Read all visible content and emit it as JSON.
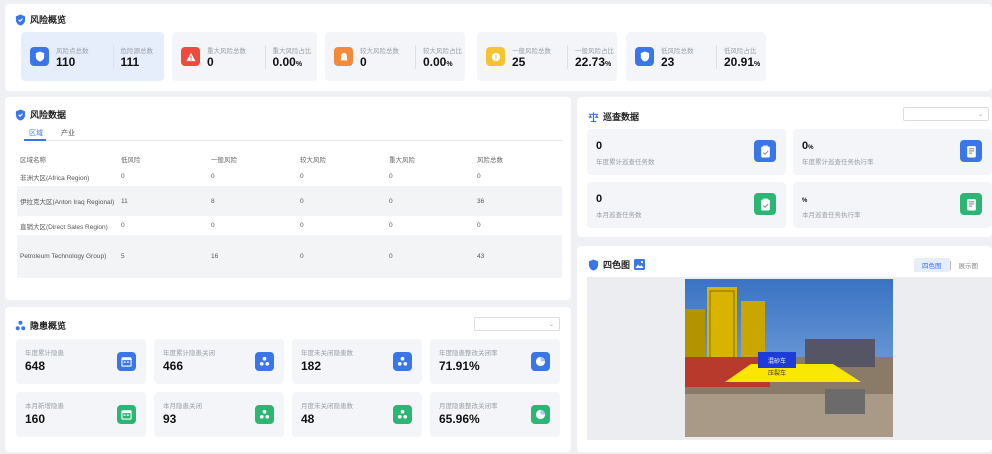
{
  "risk_overview": {
    "title": "风险概览",
    "stats": [
      {
        "labels": [
          "风险点总数",
          "危险源总数"
        ],
        "values": [
          "110",
          "111"
        ],
        "color": "#3a76e8",
        "icon": "shield-icon"
      },
      {
        "labels": [
          "重大风险总数",
          "重大风险占比"
        ],
        "values": [
          "0",
          "0.00"
        ],
        "unit": "%",
        "color": "#ee4b3e",
        "icon": "warning-triangle-icon"
      },
      {
        "labels": [
          "较大风险总数",
          "较大风险占比"
        ],
        "values": [
          "0",
          "0.00"
        ],
        "unit": "%",
        "color": "#f5893a",
        "icon": "bell-icon"
      },
      {
        "labels": [
          "一般风险总数",
          "一般风险占比"
        ],
        "values": [
          "25",
          "22.73"
        ],
        "unit": "%",
        "color": "#f4c430",
        "icon": "alert-circle-icon"
      },
      {
        "labels": [
          "低风险总数",
          "低风险占比"
        ],
        "values": [
          "23",
          "20.91"
        ],
        "unit": "%",
        "color": "#3a76e8",
        "icon": "shield-icon"
      }
    ]
  },
  "risk_data": {
    "title": "风险数据",
    "tabs": [
      "区域",
      "产业"
    ],
    "columns": [
      "区域名称",
      "低风险",
      "一般风险",
      "较大风险",
      "重大风险",
      "风险总数"
    ],
    "rows": [
      [
        "非洲大区(Africa Region)",
        "0",
        "0",
        "0",
        "0",
        "0"
      ],
      [
        "伊拉克大区(Anton Iraq Regional)",
        "11",
        "8",
        "0",
        "0",
        "36"
      ],
      [
        "直销大区(Direct Sales Region)",
        "0",
        "0",
        "0",
        "0",
        "0"
      ],
      [
        "Petroleum Technology Group)",
        "5",
        "16",
        "0",
        "0",
        "43"
      ]
    ]
  },
  "hazard_overview": {
    "title": "隐患概览",
    "cards": [
      {
        "label": "年度累计隐患",
        "value": "648",
        "color": "#3a76e8",
        "icon": "calendar-icon"
      },
      {
        "label": "年度累计隐患关闭",
        "value": "466",
        "color": "#3a76e8",
        "icon": "hazard-icon"
      },
      {
        "label": "年度未关闭隐患数",
        "value": "182",
        "color": "#3a76e8",
        "icon": "hazard-icon"
      },
      {
        "label": "年度隐患整改关闭率",
        "value": "71.91%",
        "color": "#3a76e8",
        "icon": "pie-icon"
      },
      {
        "label": "本月新增隐患",
        "value": "160",
        "color": "#2bb673",
        "icon": "calendar-icon"
      },
      {
        "label": "本月隐患关闭",
        "value": "93",
        "color": "#2bb673",
        "icon": "hazard-icon"
      },
      {
        "label": "月度未关闭隐患数",
        "value": "48",
        "color": "#2bb673",
        "icon": "hazard-icon"
      },
      {
        "label": "月度隐患整改关闭率",
        "value": "65.96%",
        "color": "#2bb673",
        "icon": "pie-icon"
      }
    ]
  },
  "patrol_data": {
    "title": "巡查数据",
    "cards": [
      {
        "value": "0",
        "unit": "",
        "label": "年度累计巡查任务数",
        "color": "#3a76e8",
        "icon": "clipboard-check-icon"
      },
      {
        "value": "0",
        "unit": "%",
        "label": "年度累计巡查任务执行率",
        "color": "#3a76e8",
        "icon": "report-icon"
      },
      {
        "value": "0",
        "unit": "",
        "label": "本月巡查任务数",
        "color": "#2bb673",
        "icon": "clipboard-check-icon"
      },
      {
        "value": "",
        "unit": "%",
        "label": "本月巡查任务执行率",
        "color": "#2bb673",
        "icon": "report-icon"
      }
    ]
  },
  "four_color": {
    "title": "四色图",
    "buttons": [
      "四色图",
      "展示图"
    ],
    "photo_tag_line1": "混砂车",
    "photo_tag_line2": "压裂车"
  }
}
